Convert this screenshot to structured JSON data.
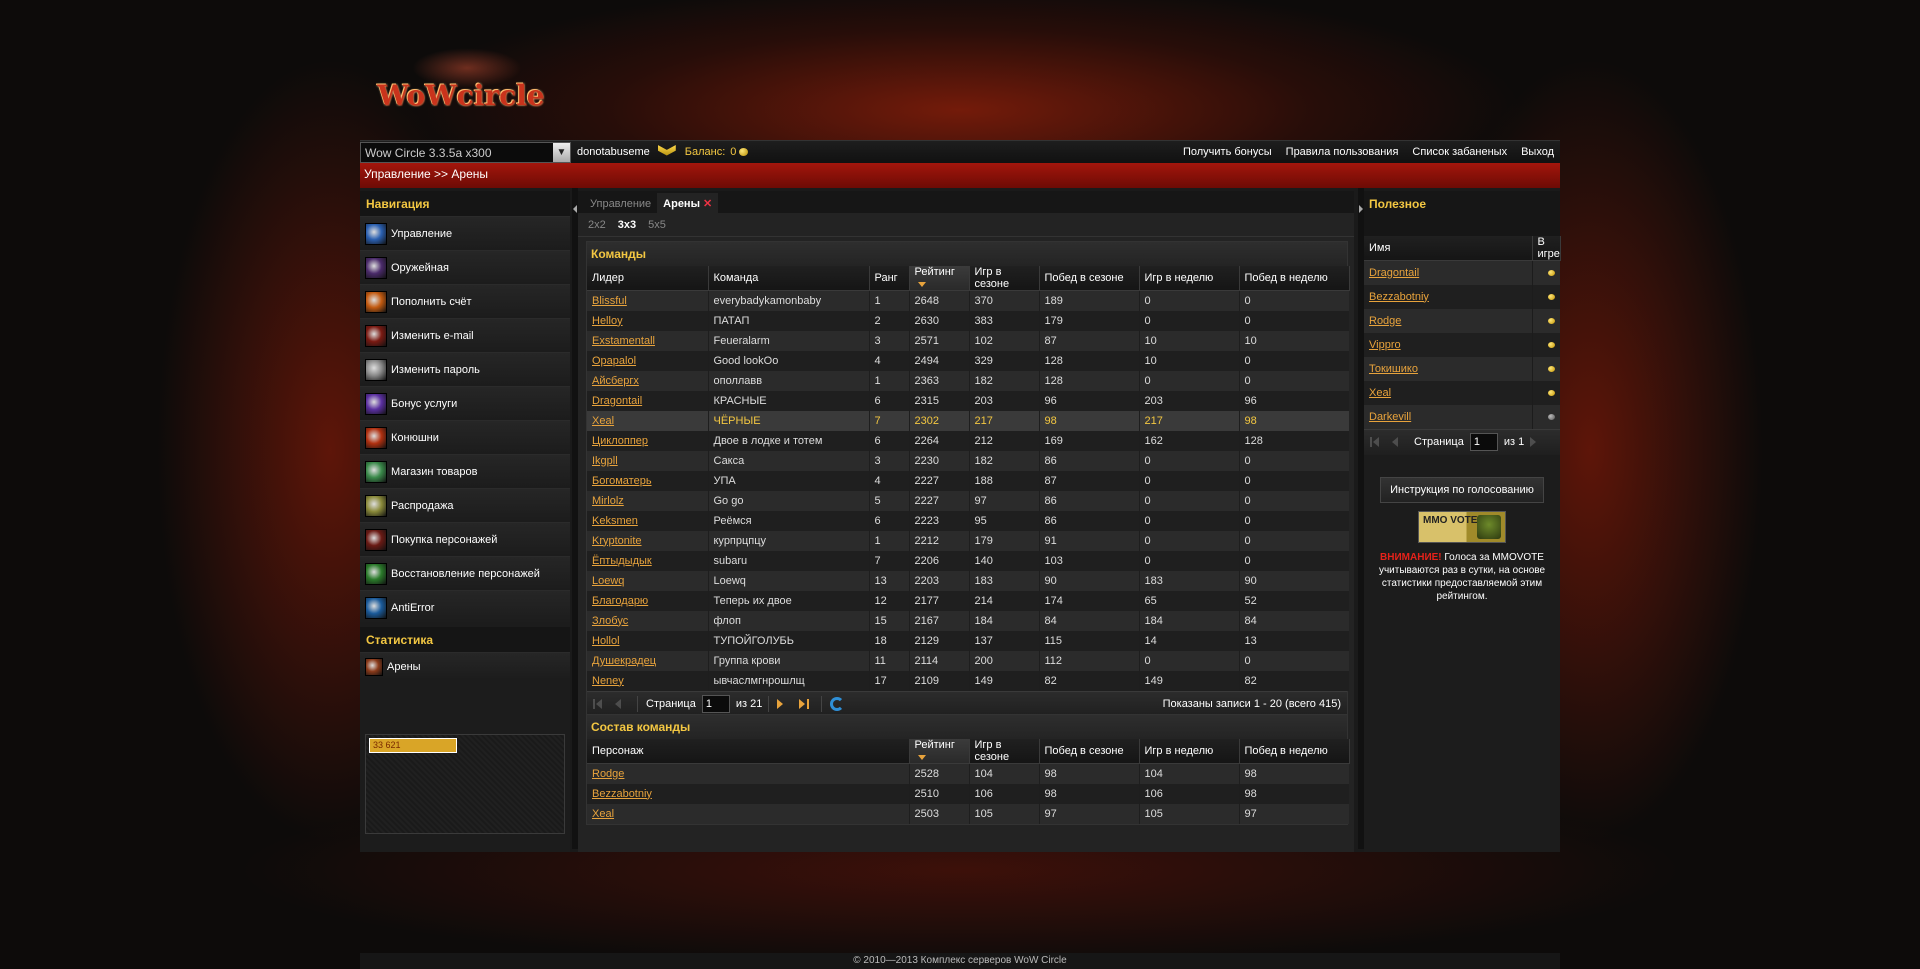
{
  "site": {
    "logo_text": "WoWcircle"
  },
  "topbar": {
    "realm": "Wow Circle 3.3.5a x300",
    "username": "donotabuseme",
    "balance_label": "Баланс:",
    "balance_value": "0",
    "links": [
      "Получить бонусы",
      "Правила пользования",
      "Список забаненых",
      "Выход"
    ]
  },
  "breadcrumb": "Управление >> Арены",
  "sidebar": {
    "nav_title": "Навигация",
    "items": [
      {
        "label": "Управление",
        "color": "#2a5fb0"
      },
      {
        "label": "Оружейная",
        "color": "#4a2a6a"
      },
      {
        "label": "Пополнить счёт",
        "color": "#c25a10"
      },
      {
        "label": "Изменить e-mail",
        "color": "#7a1a12"
      },
      {
        "label": "Изменить пароль",
        "color": "#8a8a8a"
      },
      {
        "label": "Бонус услуги",
        "color": "#5a2fa0"
      },
      {
        "label": "Конюшни",
        "color": "#b03010"
      },
      {
        "label": "Магазин товаров",
        "color": "#3a8a4a"
      },
      {
        "label": "Распродажа",
        "color": "#8a8a3a"
      },
      {
        "label": "Покупка персонажей",
        "color": "#6a1a14"
      },
      {
        "label": "Восстановление персонажей",
        "color": "#2a7a2a"
      },
      {
        "label": "AntiError",
        "color": "#1a5a9a"
      }
    ],
    "stats_title": "Статистика",
    "stats_items": [
      {
        "label": "Арены",
        "color": "#8a3a1a"
      }
    ],
    "counter": "33 621"
  },
  "main": {
    "tabs": [
      {
        "label": "Управление"
      },
      {
        "label": "Арены"
      }
    ],
    "subtabs": [
      "2x2",
      "3x3",
      "5x5"
    ],
    "teams": {
      "title": "Команды",
      "columns": [
        "Лидер",
        "Команда",
        "Ранг",
        "Рейтинг",
        "Игр в сезоне",
        "Побед в сезоне",
        "Игр в неделю",
        "Побед в неделю"
      ],
      "rows": [
        [
          "Blissful",
          "everybadykamonbaby",
          "1",
          "2648",
          "370",
          "189",
          "0",
          "0"
        ],
        [
          "Helloy",
          "ПАТАП",
          "2",
          "2630",
          "383",
          "179",
          "0",
          "0"
        ],
        [
          "Exstamentall",
          "Feueralarm",
          "3",
          "2571",
          "102",
          "87",
          "10",
          "10"
        ],
        [
          "Opapalol",
          "Good lookOo",
          "4",
          "2494",
          "329",
          "128",
          "10",
          "0"
        ],
        [
          "Айсбергх",
          "ополлавв",
          "1",
          "2363",
          "182",
          "128",
          "0",
          "0"
        ],
        [
          "Dragontail",
          "КРАСНЫЕ",
          "6",
          "2315",
          "203",
          "96",
          "203",
          "96"
        ],
        [
          "Xeal",
          "ЧЁРНЫЕ",
          "7",
          "2302",
          "217",
          "98",
          "217",
          "98"
        ],
        [
          "Циклоппер",
          "Двое в лодке и тотем",
          "6",
          "2264",
          "212",
          "169",
          "162",
          "128"
        ],
        [
          "Ikgpll",
          "Сакса",
          "3",
          "2230",
          "182",
          "86",
          "0",
          "0"
        ],
        [
          "Богоматерь",
          "УПА",
          "4",
          "2227",
          "188",
          "87",
          "0",
          "0"
        ],
        [
          "Mirlolz",
          "Go go",
          "5",
          "2227",
          "97",
          "86",
          "0",
          "0"
        ],
        [
          "Keksmen",
          "Реёмся",
          "6",
          "2223",
          "95",
          "86",
          "0",
          "0"
        ],
        [
          "Kryptonite",
          "курпрцпцу",
          "1",
          "2212",
          "179",
          "91",
          "0",
          "0"
        ],
        [
          "Ёптыдыдык",
          "subaru",
          "7",
          "2206",
          "140",
          "103",
          "0",
          "0"
        ],
        [
          "Loewq",
          "Loewq",
          "13",
          "2203",
          "183",
          "90",
          "183",
          "90"
        ],
        [
          "Благодарю",
          "Теперь их двое",
          "12",
          "2177",
          "214",
          "174",
          "65",
          "52"
        ],
        [
          "Злобус",
          "флоп",
          "15",
          "2167",
          "184",
          "84",
          "184",
          "84"
        ],
        [
          "Hollol",
          "ТУПОЙГОЛУБЬ",
          "18",
          "2129",
          "137",
          "115",
          "14",
          "13"
        ],
        [
          "Душекрадец",
          "Группа крови",
          "11",
          "2114",
          "200",
          "112",
          "0",
          "0"
        ],
        [
          "Neney",
          "ывчаслмгнрошлщ",
          "17",
          "2109",
          "149",
          "82",
          "149",
          "82"
        ]
      ],
      "pager": {
        "page_label": "Страница",
        "page": "1",
        "of": "из 21",
        "info": "Показаны записи 1 - 20 (всего 415)"
      }
    },
    "roster": {
      "title": "Состав команды",
      "columns": [
        "Персонаж",
        "Рейтинг",
        "Игр в сезоне",
        "Побед в сезоне",
        "Игр в неделю",
        "Побед в неделю"
      ],
      "rows": [
        [
          "Rodge",
          "2528",
          "104",
          "98",
          "104",
          "98"
        ],
        [
          "Bezzabotniy",
          "2510",
          "106",
          "98",
          "106",
          "98"
        ],
        [
          "Xeal",
          "2503",
          "105",
          "97",
          "105",
          "97"
        ]
      ]
    }
  },
  "right": {
    "title": "Полезное",
    "columns": [
      "Имя",
      "В игре"
    ],
    "rows": [
      {
        "name": "Dragontail",
        "online": true
      },
      {
        "name": "Bezzabotniy",
        "online": true
      },
      {
        "name": "Rodge",
        "online": true
      },
      {
        "name": "Vippro",
        "online": true
      },
      {
        "name": "Токишико",
        "online": true
      },
      {
        "name": "Xeal",
        "online": true
      },
      {
        "name": "Darkevill",
        "online": false
      }
    ],
    "pager": {
      "page_label": "Страница",
      "page": "1",
      "of": "из 1"
    },
    "vote_button": "Инструкция по голосованию",
    "banner": "MMO VOTE",
    "warning_strong": "ВНИМАНИЕ!",
    "warning_text": "Голоса за MMOVOTE учитываются раз в сутки, на основе статистики предоставляемой этим рейтингом."
  },
  "footer": "© 2010—2013 Комплекс серверов WoW Circle"
}
